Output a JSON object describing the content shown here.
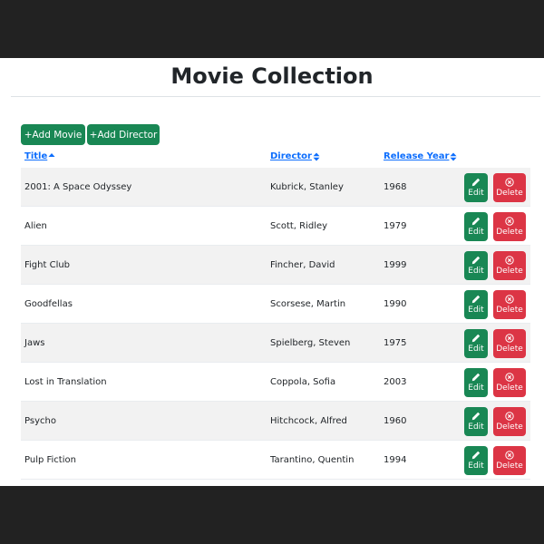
{
  "page": {
    "title": "Movie Collection"
  },
  "toolbar": {
    "add_movie_label": "+Add Movie",
    "add_director_label": "+Add Director"
  },
  "table": {
    "columns": {
      "title": "Title",
      "director": "Director",
      "release_year": "Release Year"
    },
    "sort": {
      "column": "title",
      "direction": "ascending"
    },
    "action_labels": {
      "edit": "Edit",
      "delete": "Delete"
    },
    "rows": [
      {
        "title": "2001: A Space Odyssey",
        "director": "Kubrick, Stanley",
        "year": "1968"
      },
      {
        "title": "Alien",
        "director": "Scott, Ridley",
        "year": "1979"
      },
      {
        "title": "Fight Club",
        "director": "Fincher, David",
        "year": "1999"
      },
      {
        "title": "Goodfellas",
        "director": "Scorsese, Martin",
        "year": "1990"
      },
      {
        "title": "Jaws",
        "director": "Spielberg, Steven",
        "year": "1975"
      },
      {
        "title": "Lost in Translation",
        "director": "Coppola, Sofia",
        "year": "2003"
      },
      {
        "title": "Psycho",
        "director": "Hitchcock, Alfred",
        "year": "1960"
      },
      {
        "title": "Pulp Fiction",
        "director": "Tarantino, Quentin",
        "year": "1994"
      }
    ]
  },
  "colors": {
    "primary_button": "#198754",
    "danger_button": "#dc3545",
    "link": "#0d6efd",
    "stripe": "#f2f2f2",
    "frame": "#222222"
  },
  "icons": {
    "sort_ascending": "sort-up-icon",
    "sort_both": "sort-both-icon",
    "edit": "pencil-icon",
    "delete": "x-circle-icon"
  }
}
